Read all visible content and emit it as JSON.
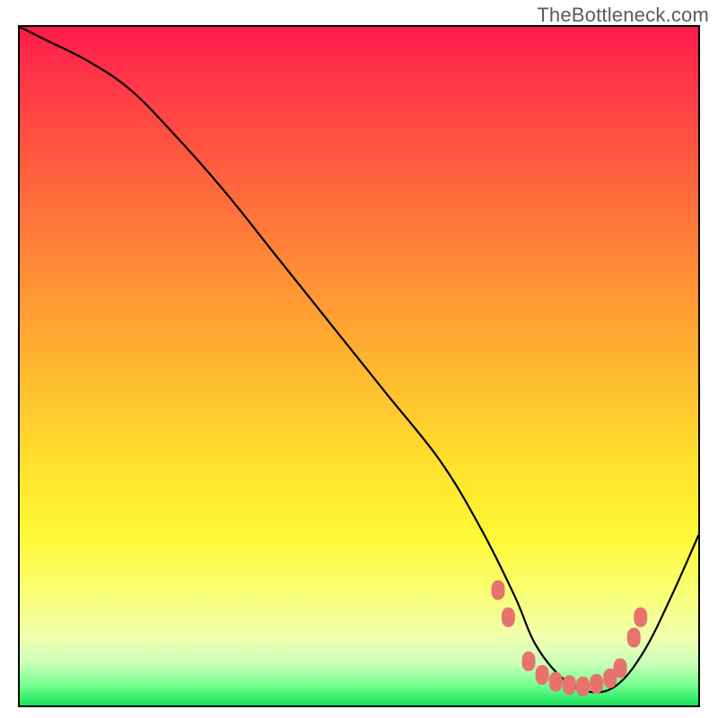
{
  "watermark": {
    "text": "TheBottleneck.com"
  },
  "chart_data": {
    "type": "line",
    "title": "",
    "xlabel": "",
    "ylabel": "",
    "xlim": [
      0,
      100
    ],
    "ylim": [
      0,
      100
    ],
    "grid": false,
    "legend": false,
    "gradient_stops": [
      {
        "pos": 0,
        "color": "#ff1a4b"
      },
      {
        "pos": 18,
        "color": "#ff5640"
      },
      {
        "pos": 42,
        "color": "#ff9e33"
      },
      {
        "pos": 65,
        "color": "#ffe22e"
      },
      {
        "pos": 83,
        "color": "#f9ff70"
      },
      {
        "pos": 94,
        "color": "#c8ffb8"
      },
      {
        "pos": 100,
        "color": "#16e45c"
      }
    ],
    "series": [
      {
        "name": "bottleneck-curve",
        "stroke": "#000000",
        "x": [
          0,
          4,
          10,
          16,
          22,
          30,
          38,
          46,
          54,
          62,
          68,
          73,
          76,
          80,
          84,
          88,
          92,
          96,
          100
        ],
        "values": [
          100,
          98,
          95,
          91,
          85,
          76,
          66,
          56,
          46,
          36,
          26,
          16,
          9,
          4,
          2,
          3,
          8,
          16,
          25
        ]
      }
    ],
    "markers": {
      "name": "highlight-dots",
      "fill": "#e9716e",
      "points": [
        {
          "x": 70.5,
          "y": 17.0
        },
        {
          "x": 72.0,
          "y": 13.0
        },
        {
          "x": 75.0,
          "y": 6.5
        },
        {
          "x": 77.0,
          "y": 4.5
        },
        {
          "x": 79.0,
          "y": 3.5
        },
        {
          "x": 81.0,
          "y": 3.0
        },
        {
          "x": 83.0,
          "y": 2.8
        },
        {
          "x": 85.0,
          "y": 3.2
        },
        {
          "x": 87.0,
          "y": 4.0
        },
        {
          "x": 88.5,
          "y": 5.5
        },
        {
          "x": 90.5,
          "y": 10.0
        },
        {
          "x": 91.5,
          "y": 13.0
        }
      ]
    }
  }
}
